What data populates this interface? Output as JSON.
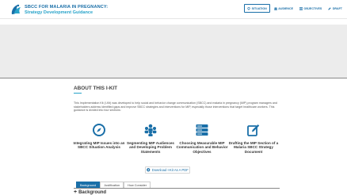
{
  "brand": {
    "title_line1": "SBCC FOR MALARIA IN PREGNANCY:",
    "title_line2": "Strategy Development Guidance",
    "primary_color": "#1a6fa8",
    "accent_color": "#27a3c9"
  },
  "nav": {
    "items": [
      {
        "label": "SITUATION",
        "icon": "pin-icon",
        "active": true
      },
      {
        "label": "AUDIENCE",
        "icon": "people-icon",
        "active": false
      },
      {
        "label": "OBJECTIVES",
        "icon": "list-icon",
        "active": false
      },
      {
        "label": "DRAFT",
        "icon": "pencil-icon",
        "active": false
      }
    ]
  },
  "about": {
    "title": "ABOUT THIS I-KIT",
    "body": "This Implementation Kit (I-Kit) was developed to help social and behavior change communication (SBCC) and malaria in pregnancy (MIP) program managers and stakeholders address identified gaps and improve SBCC strategies and interventions for MIP, especially those interventions that target healthcare workers. This guidance is divided into four sections:"
  },
  "sections": [
    {
      "label": "Integrating MIP Issues into an SBCC Situation Analysis",
      "icon": "compass-icon"
    },
    {
      "label": "Segmenting MIP Audiences and Developing Problem Statements",
      "icon": "people-icon"
    },
    {
      "label": "Choosing Measurable MIP Communication and Behavior Objectives",
      "icon": "server-icon"
    },
    {
      "label": "Drafting the MIP Section of a Malaria SBCC Strategy Document",
      "icon": "edit-icon"
    }
  ],
  "download": {
    "label": "Download I-Kit As A PDF",
    "icon": "download-icon"
  },
  "tabs": [
    {
      "label": "Background",
      "active": true
    },
    {
      "label": "Justification",
      "active": false
    },
    {
      "label": "How Consider",
      "active": false
    }
  ],
  "accordion": {
    "label": "Background",
    "icon": "plus-icon"
  }
}
